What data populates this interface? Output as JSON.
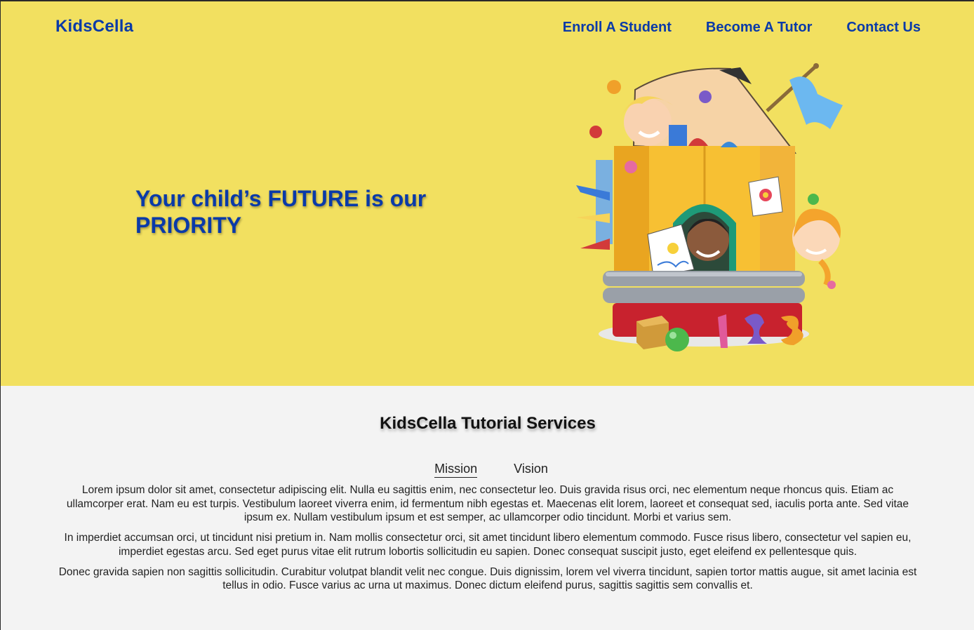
{
  "header": {
    "logo": "KidsCella",
    "nav": [
      {
        "label": "Enroll A Student"
      },
      {
        "label": "Become A Tutor"
      },
      {
        "label": "Contact Us"
      }
    ]
  },
  "hero": {
    "headline": "Your child’s FUTURE is our PRIORITY"
  },
  "services": {
    "title": "KidsCella Tutorial Services",
    "tabs": [
      {
        "label": "Mission",
        "active": true
      },
      {
        "label": "Vision",
        "active": false
      }
    ],
    "paragraphs": [
      "Lorem ipsum dolor sit amet, consectetur adipiscing elit. Nulla eu sagittis enim, nec consectetur leo. Duis gravida risus orci, nec elementum neque rhoncus quis. Etiam ac ullamcorper erat. Nam eu est turpis. Vestibulum laoreet viverra enim, id fermentum nibh egestas et. Maecenas elit lorem, laoreet et consequat sed, iaculis porta ante. Sed vitae ipsum ex. Nullam vestibulum ipsum et est semper, ac ullamcorper odio tincidunt. Morbi et varius sem.",
      "In imperdiet accumsan orci, ut tincidunt nisi pretium in. Nam mollis consectetur orci, sit amet tincidunt libero elementum commodo. Fusce risus libero, consectetur vel sapien eu, imperdiet egestas arcu. Sed eget purus vitae elit rutrum lobortis sollicitudin eu sapien. Donec consequat suscipit justo, eget eleifend ex pellentesque quis.",
      "Donec gravida sapien non sagittis sollicitudin. Curabitur volutpat blandit velit nec congue. Duis dignissim, lorem vel viverra tincidunt, sapien tortor mattis augue, sit amet lacinia est tellus in odio. Fusce varius ac urna ut maximus. Donec dictum eleifend purus, sagittis sagittis sem convallis et."
    ]
  },
  "colors": {
    "hero_bg": "#f2e060",
    "brand_blue": "#0a3aa8",
    "section_bg": "#f3f3f3"
  }
}
